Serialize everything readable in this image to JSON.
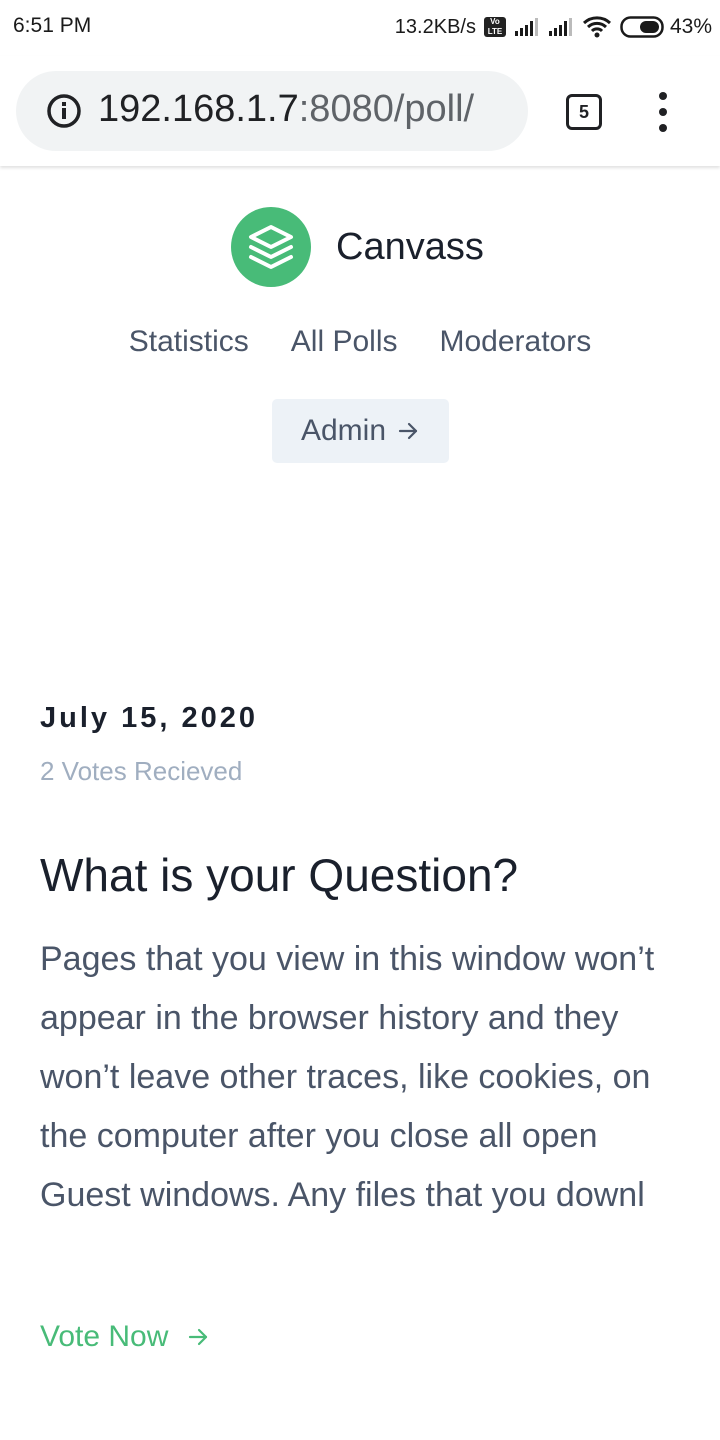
{
  "status_bar": {
    "time": "6:51 PM",
    "net_speed": "13.2KB/s",
    "volte": "Vo LTE",
    "battery": "43%"
  },
  "browser": {
    "url_host": "192.168.1.7",
    "url_rest": ":8080/poll/",
    "tab_count": "5"
  },
  "site": {
    "brand_name": "Canvass",
    "nav": {
      "statistics": "Statistics",
      "all_polls": "All Polls",
      "moderators": "Moderators"
    },
    "admin_label": "Admin"
  },
  "poll": {
    "date": "July 15, 2020",
    "votes": "2 Votes Recieved",
    "question": "What is your Question?",
    "description": "Pages that you view in this window won’t appear in the browser history and they won’t leave other traces, like cookies, on the computer after you close all open Guest windows. Any files that you downl",
    "vote_label": "Vote Now"
  },
  "colors": {
    "accent": "#48bb78",
    "text_dark": "#1a202c",
    "text_muted": "#4a5568",
    "text_light": "#a0aec0"
  },
  "icons": {
    "info": "info-icon",
    "tabs": "tabs-icon",
    "menu": "more-vert-icon",
    "logo": "layers-icon",
    "arrow": "arrow-right-icon",
    "wifi": "wifi-icon",
    "signal": "signal-icon",
    "battery": "battery-icon"
  }
}
